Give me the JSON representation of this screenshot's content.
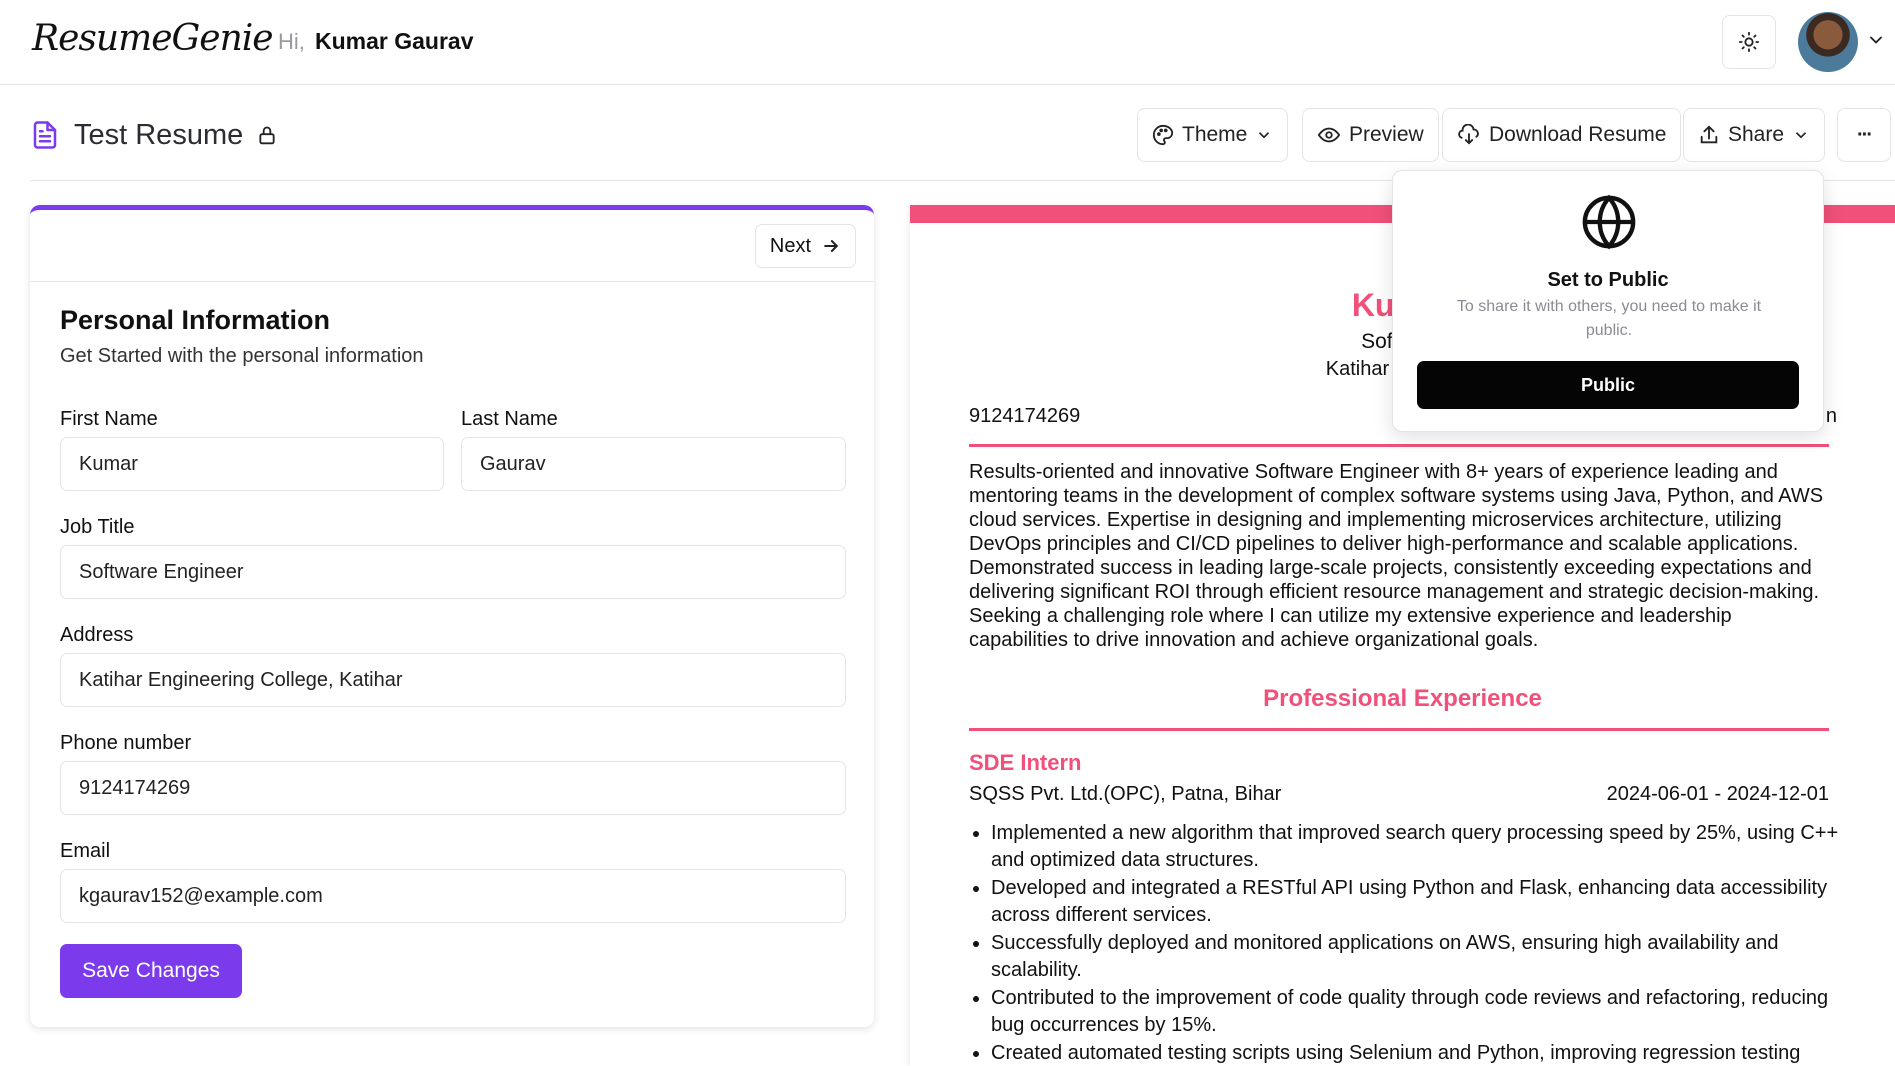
{
  "header": {
    "logo_text": "ResumeGenie",
    "greeting": "Hi,",
    "user_name": "Kumar Gaurav",
    "icons": {
      "theme_toggle": "sun-icon",
      "user_menu": "chevron-down-icon"
    }
  },
  "toolbar": {
    "doc_title": "Test Resume",
    "theme_label": "Theme",
    "preview_label": "Preview",
    "download_label": "Download Resume",
    "share_label": "Share",
    "more_label": "···"
  },
  "form": {
    "next_label": "Next",
    "section_title": "Personal Information",
    "section_subtitle": "Get Started with the personal information",
    "fields": {
      "first_name": {
        "label": "First Name",
        "value": "Kumar"
      },
      "last_name": {
        "label": "Last Name",
        "value": "Gaurav"
      },
      "job_title": {
        "label": "Job Title",
        "value": "Software Engineer"
      },
      "address": {
        "label": "Address",
        "value": "Katihar Engineering College, Katihar"
      },
      "phone": {
        "label": "Phone number",
        "value": "9124174269"
      },
      "email": {
        "label": "Email",
        "value": "kgaurav152@example.com"
      }
    },
    "save_label": "Save Changes"
  },
  "resume": {
    "accent_color": "#f0507a",
    "name": "Kumar",
    "job_title": "Software",
    "address": "Katihar Engineeri",
    "phone": "9124174269",
    "email_fragment": "n",
    "summary": "Results-oriented and innovative Software Engineer with 8+ years of experience leading and mentoring teams in the development of complex software systems using Java, Python, and AWS cloud services. Expertise in designing and implementing microservices architecture, utilizing DevOps principles and CI/CD pipelines to deliver high-performance and scalable applications. Demonstrated success in leading large-scale projects, consistently exceeding expectations and delivering significant ROI through efficient resource management and strategic decision-making. Seeking a challenging role where I can utilize my extensive experience and leadership capabilities to drive innovation and achieve organizational goals.",
    "experience_heading": "Professional Experience",
    "experience": {
      "role": "SDE Intern",
      "company": "SQSS Pvt. Ltd.(OPC), Patna, Bihar",
      "dates": "2024-06-01 - 2024-12-01",
      "bullets": [
        "Implemented a new algorithm that improved search query processing speed by 25%, using C++ and optimized data structures.",
        "Developed and integrated a RESTful API using Python and Flask, enhancing data accessibility across different services.",
        "Successfully deployed and monitored applications on AWS, ensuring high availability and scalability.",
        "Contributed to the improvement of code quality through code reviews and refactoring, reducing bug occurrences by 15%.",
        "Created automated testing scripts using Selenium and Python, improving regression testing"
      ]
    }
  },
  "share_popover": {
    "icon": "globe-icon",
    "title": "Set to Public",
    "description": "To share it with others, you need to make it public.",
    "button_label": "Public"
  }
}
